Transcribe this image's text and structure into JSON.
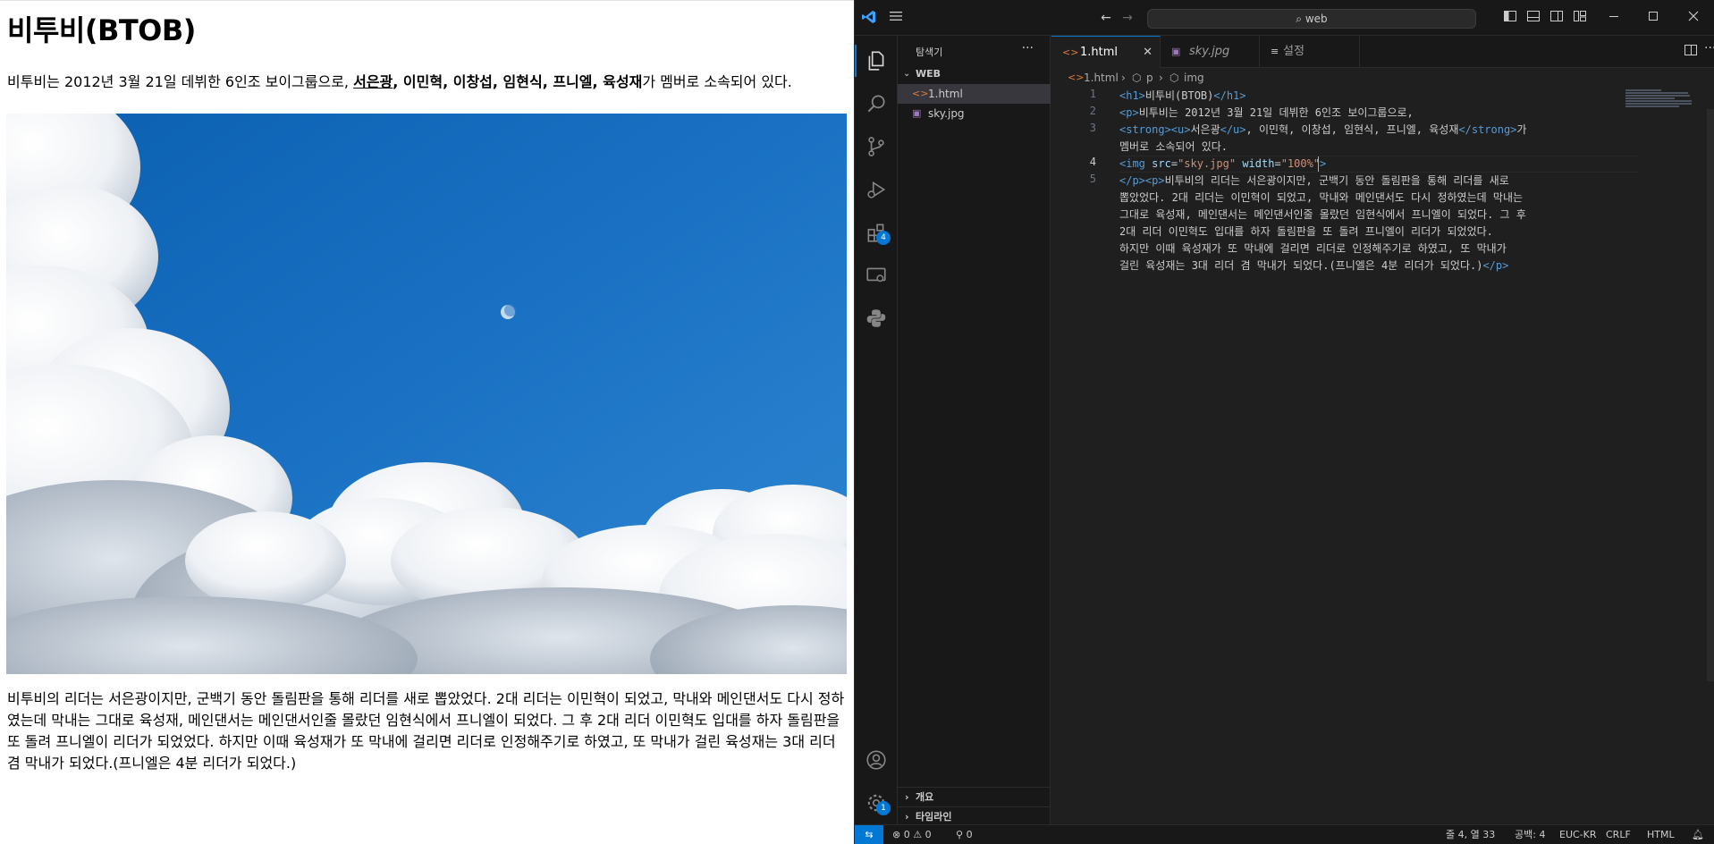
{
  "preview": {
    "heading": "비투비(BTOB)",
    "intro_text": "비투비는 2012년 3월 21일 데뷔한 6인조 보이그룹으로, ",
    "intro_member_leader": "서은광",
    "intro_members_rest": ", 이민혁, 이창섭, 임현식, 프니엘, 육성재",
    "intro_suffix": "가 멤버로 소속되어 있다.",
    "paragraph": "비투비의 리더는 서은광이지만, 군백기 동안 돌림판을 통해 리더를 새로 뽑았었다. 2대 리더는 이민혁이 되었고, 막내와 메인댄서도 다시 정하였는데 막내는 그대로 육성재, 메인댄서는 메인댄서인줄 몰랐던 임현식에서 프니엘이 되었다. 그 후 2대 리더 이민혁도 입대를 하자 돌림판을 또 돌려 프니엘이 리더가 되었었다. 하지만 이때 육성재가 또 막내에 걸리면 리더로 인정해주기로 하였고, 또 막내가 걸린 육성재는 3대 리더 겸 막내가 되었다.(프니엘은 4분 리더가 되었다.)"
  },
  "vscode": {
    "search_text": "web",
    "explorer_title": "탐색기",
    "folder_name": "WEB",
    "files": [
      "1.html",
      "sky.jpg"
    ],
    "outline_label": "개요",
    "timeline_label": "타임라인",
    "tabs": [
      "1.html",
      "sky.jpg",
      "설정"
    ],
    "breadcrumb": [
      "1.html",
      "p",
      "img"
    ],
    "extensions_badge": "4",
    "manage_badge": "1",
    "line_numbers": [
      "1",
      "2",
      "3",
      "4",
      "5"
    ],
    "code": {
      "l1_tag_open": "<h1>",
      "l1_text": "비투비(BTOB)",
      "l1_tag_close": "</h1>",
      "l2_tag": "<p>",
      "l2_text": "비투비는 2012년 3월 21일 데뷔한 6인조 보이그룹으로,",
      "l3_strong": "<strong>",
      "l3_u": "<u>",
      "l3_name": "서은광",
      "l3_u_close": "</u>",
      "l3_rest": ", 이민혁, 이창섭, 임현식, 프니엘, 육성재",
      "l3_strong_close": "</strong>",
      "l3_end": "가",
      "l3b": "멤버로 소속되어 있다.",
      "l4_img": "<img",
      "l4_src": "src",
      "l4_eq1": "=",
      "l4_src_val": "\"sky.jpg\"",
      "l4_width": "width",
      "l4_eq2": "=",
      "l4_width_val": "\"100%\"",
      "l4_close": ">",
      "l5_tags": "</p><p>",
      "l5_text": "비투비의 리더는 서은광이지만, 군백기 동안 돌림판을 통해 리더를 새로",
      "l5b": "뽑았었다. 2대 리더는 이민혁이 되었고, 막내와 메인댄서도 다시 정하였는데 막내는",
      "l5c": "그대로 육성재, 메인댄서는 메인댄서인줄 몰랐던 임현식에서 프니엘이 되었다. 그 후",
      "l5d": "2대 리더 이민혁도 입대를 하자 돌림판을 또 돌려 프니엘이 리더가 되었었다.",
      "l5e": "하지만 이때 육성재가 또 막내에 걸리면 리더로 인정해주기로 하였고, 또 막내가",
      "l5f": "걸린 육성재는 3대 리더 겸 막내가 되었다.(프니엘은 4분 리더가 되었다.)",
      "l5f_close": "</p>"
    },
    "status": {
      "errors": "0",
      "warnings": "0",
      "ports": "0",
      "position": "줄 4, 열 33",
      "spaces": "공백: 4",
      "encoding": "EUC-KR",
      "eol": "CRLF",
      "language": "HTML"
    }
  }
}
